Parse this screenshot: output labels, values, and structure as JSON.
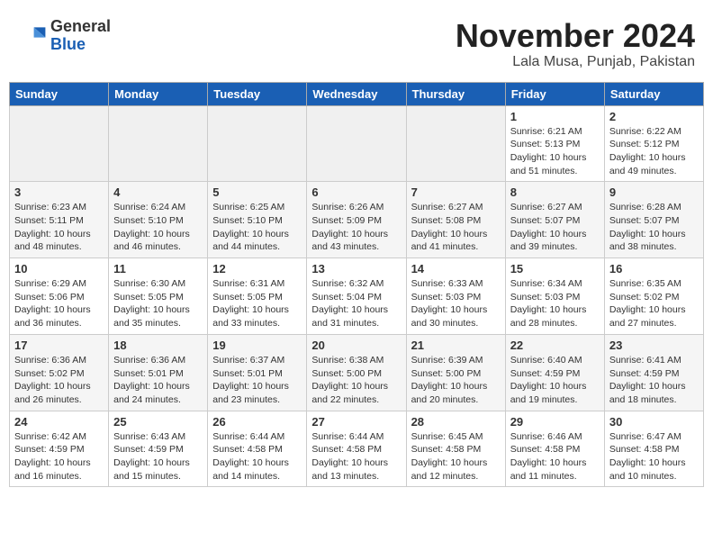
{
  "header": {
    "logo_general": "General",
    "logo_blue": "Blue",
    "month": "November 2024",
    "location": "Lala Musa, Punjab, Pakistan"
  },
  "weekdays": [
    "Sunday",
    "Monday",
    "Tuesday",
    "Wednesday",
    "Thursday",
    "Friday",
    "Saturday"
  ],
  "weeks": [
    [
      {
        "day": "",
        "empty": true
      },
      {
        "day": "",
        "empty": true
      },
      {
        "day": "",
        "empty": true
      },
      {
        "day": "",
        "empty": true
      },
      {
        "day": "",
        "empty": true
      },
      {
        "day": "1",
        "sunrise": "6:21 AM",
        "sunset": "5:13 PM",
        "daylight": "10 hours and 51 minutes."
      },
      {
        "day": "2",
        "sunrise": "6:22 AM",
        "sunset": "5:12 PM",
        "daylight": "10 hours and 49 minutes."
      }
    ],
    [
      {
        "day": "3",
        "sunrise": "6:23 AM",
        "sunset": "5:11 PM",
        "daylight": "10 hours and 48 minutes."
      },
      {
        "day": "4",
        "sunrise": "6:24 AM",
        "sunset": "5:10 PM",
        "daylight": "10 hours and 46 minutes."
      },
      {
        "day": "5",
        "sunrise": "6:25 AM",
        "sunset": "5:10 PM",
        "daylight": "10 hours and 44 minutes."
      },
      {
        "day": "6",
        "sunrise": "6:26 AM",
        "sunset": "5:09 PM",
        "daylight": "10 hours and 43 minutes."
      },
      {
        "day": "7",
        "sunrise": "6:27 AM",
        "sunset": "5:08 PM",
        "daylight": "10 hours and 41 minutes."
      },
      {
        "day": "8",
        "sunrise": "6:27 AM",
        "sunset": "5:07 PM",
        "daylight": "10 hours and 39 minutes."
      },
      {
        "day": "9",
        "sunrise": "6:28 AM",
        "sunset": "5:07 PM",
        "daylight": "10 hours and 38 minutes."
      }
    ],
    [
      {
        "day": "10",
        "sunrise": "6:29 AM",
        "sunset": "5:06 PM",
        "daylight": "10 hours and 36 minutes."
      },
      {
        "day": "11",
        "sunrise": "6:30 AM",
        "sunset": "5:05 PM",
        "daylight": "10 hours and 35 minutes."
      },
      {
        "day": "12",
        "sunrise": "6:31 AM",
        "sunset": "5:05 PM",
        "daylight": "10 hours and 33 minutes."
      },
      {
        "day": "13",
        "sunrise": "6:32 AM",
        "sunset": "5:04 PM",
        "daylight": "10 hours and 31 minutes."
      },
      {
        "day": "14",
        "sunrise": "6:33 AM",
        "sunset": "5:03 PM",
        "daylight": "10 hours and 30 minutes."
      },
      {
        "day": "15",
        "sunrise": "6:34 AM",
        "sunset": "5:03 PM",
        "daylight": "10 hours and 28 minutes."
      },
      {
        "day": "16",
        "sunrise": "6:35 AM",
        "sunset": "5:02 PM",
        "daylight": "10 hours and 27 minutes."
      }
    ],
    [
      {
        "day": "17",
        "sunrise": "6:36 AM",
        "sunset": "5:02 PM",
        "daylight": "10 hours and 26 minutes."
      },
      {
        "day": "18",
        "sunrise": "6:36 AM",
        "sunset": "5:01 PM",
        "daylight": "10 hours and 24 minutes."
      },
      {
        "day": "19",
        "sunrise": "6:37 AM",
        "sunset": "5:01 PM",
        "daylight": "10 hours and 23 minutes."
      },
      {
        "day": "20",
        "sunrise": "6:38 AM",
        "sunset": "5:00 PM",
        "daylight": "10 hours and 22 minutes."
      },
      {
        "day": "21",
        "sunrise": "6:39 AM",
        "sunset": "5:00 PM",
        "daylight": "10 hours and 20 minutes."
      },
      {
        "day": "22",
        "sunrise": "6:40 AM",
        "sunset": "4:59 PM",
        "daylight": "10 hours and 19 minutes."
      },
      {
        "day": "23",
        "sunrise": "6:41 AM",
        "sunset": "4:59 PM",
        "daylight": "10 hours and 18 minutes."
      }
    ],
    [
      {
        "day": "24",
        "sunrise": "6:42 AM",
        "sunset": "4:59 PM",
        "daylight": "10 hours and 16 minutes."
      },
      {
        "day": "25",
        "sunrise": "6:43 AM",
        "sunset": "4:59 PM",
        "daylight": "10 hours and 15 minutes."
      },
      {
        "day": "26",
        "sunrise": "6:44 AM",
        "sunset": "4:58 PM",
        "daylight": "10 hours and 14 minutes."
      },
      {
        "day": "27",
        "sunrise": "6:44 AM",
        "sunset": "4:58 PM",
        "daylight": "10 hours and 13 minutes."
      },
      {
        "day": "28",
        "sunrise": "6:45 AM",
        "sunset": "4:58 PM",
        "daylight": "10 hours and 12 minutes."
      },
      {
        "day": "29",
        "sunrise": "6:46 AM",
        "sunset": "4:58 PM",
        "daylight": "10 hours and 11 minutes."
      },
      {
        "day": "30",
        "sunrise": "6:47 AM",
        "sunset": "4:58 PM",
        "daylight": "10 hours and 10 minutes."
      }
    ]
  ]
}
